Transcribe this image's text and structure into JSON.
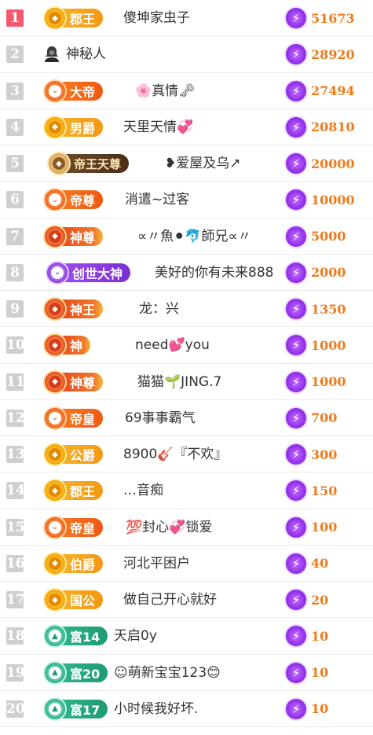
{
  "colors": {
    "rank_top": "#f25a6f",
    "rank_default": "#cfcfcf",
    "score": "#f07a1a",
    "bolt": "#8e2ee8"
  },
  "icons": {
    "score": "lightning-bolt-icon",
    "mystery": "hooded-figure-icon"
  },
  "rows": [
    {
      "rank": "1",
      "badge": "郡王",
      "variant": "gold",
      "name": "傻坤家虫子",
      "score": "51673"
    },
    {
      "rank": "2",
      "badge": "",
      "variant": "none",
      "name": "神秘人",
      "score": "28920"
    },
    {
      "rank": "3",
      "badge": "大帝",
      "variant": "orange",
      "name": "🌸真情🗝",
      "score": "27494"
    },
    {
      "rank": "4",
      "badge": "男爵",
      "variant": "gold",
      "name": "天里天情💞",
      "score": "20810"
    },
    {
      "rank": "5",
      "badge": "帝王天尊",
      "variant": "brown",
      "name": "❥爱屋及乌↗",
      "score": "20000"
    },
    {
      "rank": "6",
      "badge": "帝尊",
      "variant": "orange",
      "name": "消遣~过客",
      "score": "10000"
    },
    {
      "rank": "7",
      "badge": "神尊",
      "variant": "red",
      "name": "∝〃魚⚫🐬師兄∝〃",
      "score": "5000"
    },
    {
      "rank": "8",
      "badge": "创世大神",
      "variant": "purple",
      "name": "美好的你有未来888",
      "score": "2000"
    },
    {
      "rank": "9",
      "badge": "神王",
      "variant": "red",
      "name": "龙：兴",
      "score": "1350"
    },
    {
      "rank": "10",
      "badge": "神",
      "variant": "red",
      "name": "need💕you",
      "score": "1000"
    },
    {
      "rank": "11",
      "badge": "神尊",
      "variant": "red",
      "name": "猫猫🌱JING.7",
      "score": "1000"
    },
    {
      "rank": "12",
      "badge": "帝皇",
      "variant": "orange",
      "name": "69事事霸气",
      "score": "700"
    },
    {
      "rank": "13",
      "badge": "公爵",
      "variant": "gold",
      "name": "8900🎸『不欢』",
      "score": "300"
    },
    {
      "rank": "14",
      "badge": "郡王",
      "variant": "gold",
      "name": "…音痴",
      "score": "150"
    },
    {
      "rank": "15",
      "badge": "帝皇",
      "variant": "orange",
      "name": "💯封心💞锁爱",
      "score": "100"
    },
    {
      "rank": "16",
      "badge": "伯爵",
      "variant": "gold",
      "name": "河北平困户",
      "score": "40"
    },
    {
      "rank": "17",
      "badge": "国公",
      "variant": "gold",
      "name": "做自己开心就好",
      "score": "20"
    },
    {
      "rank": "18",
      "badge": "富14",
      "variant": "teal",
      "name": "天启0y",
      "score": "10"
    },
    {
      "rank": "19",
      "badge": "富20",
      "variant": "teal",
      "name": "☺萌新宝宝123😊",
      "score": "10"
    },
    {
      "rank": "20",
      "badge": "富17",
      "variant": "teal",
      "name": "小时候我好坏.",
      "score": "10"
    }
  ]
}
